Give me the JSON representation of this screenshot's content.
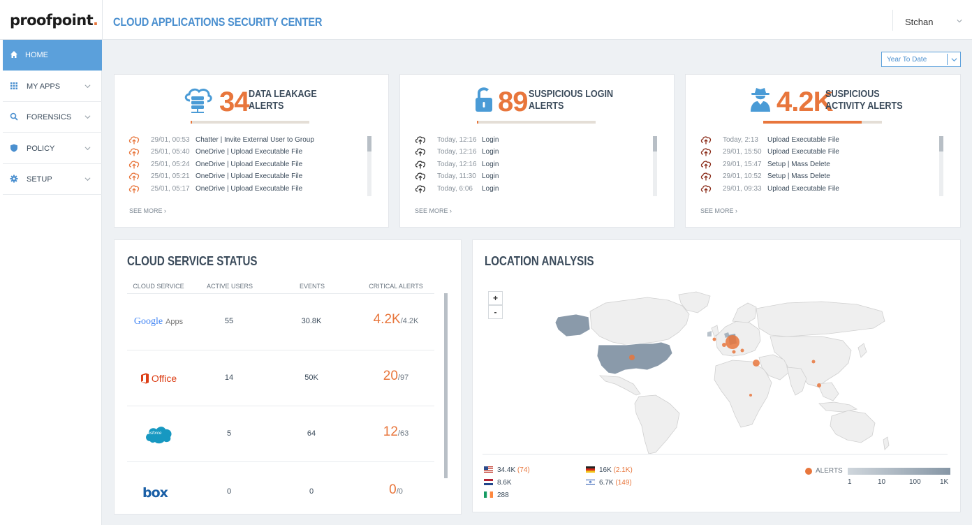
{
  "brand": {
    "name": "proofpoint",
    "accent": "#e8763c",
    "primary_blue": "#5ba0db"
  },
  "app_title": "CLOUD APPLICATIONS SECURITY CENTER",
  "user": {
    "name": "Stchan"
  },
  "nav": [
    {
      "label": "HOME",
      "icon": "home-icon",
      "active": true
    },
    {
      "label": "MY APPS",
      "icon": "grid-icon"
    },
    {
      "label": "FORENSICS",
      "icon": "search-icon"
    },
    {
      "label": "POLICY",
      "icon": "shield-icon"
    },
    {
      "label": "SETUP",
      "icon": "gear-icon"
    }
  ],
  "date_filter": {
    "value": "Year To Date"
  },
  "alert_cards": [
    {
      "count": "34",
      "title_line1": "DATA LEAKAGE",
      "title_line2": "ALERTS",
      "icon": "cloud-server-icon",
      "progress": 0.0,
      "rows": [
        {
          "time": "29/01, 00:53",
          "text": "Chatter | Invite External User to Group"
        },
        {
          "time": "25/01, 05:40",
          "text": "OneDrive | Upload Executable File"
        },
        {
          "time": "25/01, 05:24",
          "text": "OneDrive | Upload Executable File"
        },
        {
          "time": "25/01, 05:21",
          "text": "OneDrive | Upload Executable File"
        },
        {
          "time": "25/01, 05:17",
          "text": "OneDrive | Upload Executable File"
        }
      ],
      "see_more": "SEE MORE"
    },
    {
      "count": "89",
      "title_line1": "SUSPICIOUS LOGIN",
      "title_line2": "ALERTS",
      "icon": "unlocked-padlock-icon",
      "progress": 0.0,
      "rows": [
        {
          "time": "Today, 12:16",
          "text": "Login"
        },
        {
          "time": "Today, 12:16",
          "text": "Login"
        },
        {
          "time": "Today, 12:16",
          "text": "Login"
        },
        {
          "time": "Today, 11:30",
          "text": "Login"
        },
        {
          "time": "Today, 6:06",
          "text": "Login"
        }
      ],
      "see_more": "SEE MORE"
    },
    {
      "count": "4.2K",
      "title_line1": "SUSPICIOUS",
      "title_line2": "ACTIVITY ALERTS",
      "icon": "spy-icon",
      "progress": 0.83,
      "rows": [
        {
          "time": "Today, 2:13",
          "text": "Upload Executable File"
        },
        {
          "time": "29/01, 15:50",
          "text": "Upload Executable File"
        },
        {
          "time": "29/01, 15:47",
          "text": "Setup | Mass Delete"
        },
        {
          "time": "29/01, 10:52",
          "text": "Setup | Mass Delete"
        },
        {
          "time": "29/01, 09:33",
          "text": "Upload Executable File"
        }
      ],
      "see_more": "SEE MORE"
    }
  ],
  "cloud_status": {
    "title": "CLOUD SERVICE STATUS",
    "headers": [
      "CLOUD SERVICE",
      "ACTIVE USERS",
      "EVENTS",
      "CRITICAL ALERTS"
    ],
    "rows": [
      {
        "service": "Google Apps",
        "logo_word1": "Google",
        "logo_word2": "Apps",
        "active_users": "55",
        "events": "30.8K",
        "critical": "4.2K",
        "critical_total": "/4.2K"
      },
      {
        "service": "Office",
        "logo_word1": "Office",
        "active_users": "14",
        "events": "50K",
        "critical": "20",
        "critical_total": "/97"
      },
      {
        "service": "Salesforce",
        "logo_word1": "salesforce",
        "active_users": "5",
        "events": "64",
        "critical": "12",
        "critical_total": "/63"
      },
      {
        "service": "Box",
        "logo_word1": "box",
        "active_users": "0",
        "events": "0",
        "critical": "0",
        "critical_total": "/0"
      }
    ]
  },
  "location": {
    "title": "LOCATION ANALYSIS",
    "zoom_in": "+",
    "zoom_out": "-",
    "legend": [
      {
        "flag": "us-flag-icon",
        "value": "34.4K",
        "alerts": "(74)"
      },
      {
        "flag": "de-flag-icon",
        "value": "16K",
        "alerts": "(2.1K)"
      },
      {
        "flag": "nl-flag-icon",
        "value": "8.6K",
        "alerts": ""
      },
      {
        "flag": "il-flag-icon",
        "value": "6.7K",
        "alerts": "(149)"
      },
      {
        "flag": "ie-flag-icon",
        "value": "288",
        "alerts": ""
      }
    ],
    "alerts_label": "ALERTS",
    "scale_ticks": [
      "1",
      "10",
      "100",
      "1K"
    ]
  }
}
